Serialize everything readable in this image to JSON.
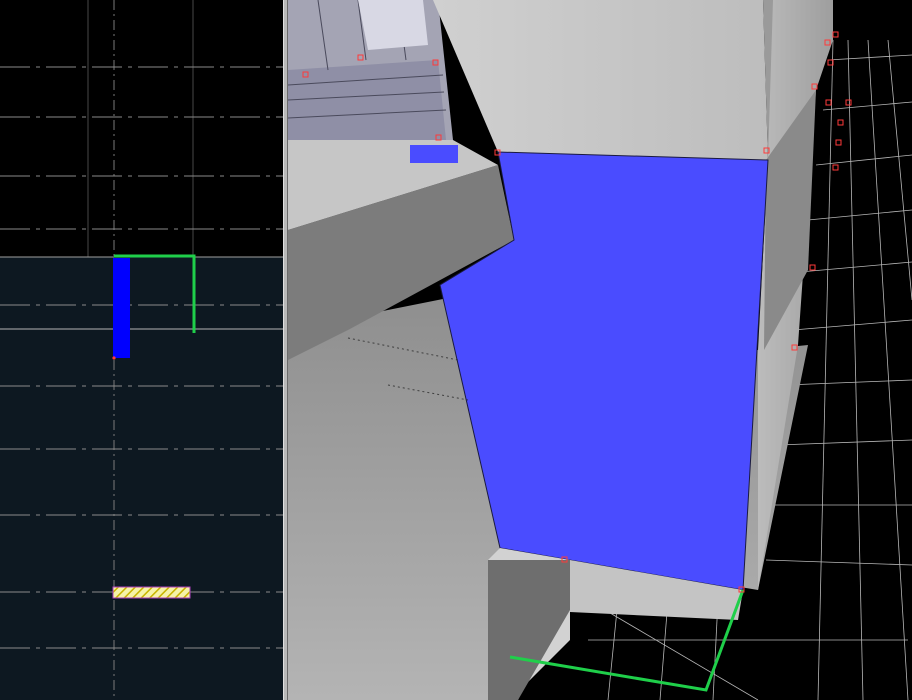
{
  "editor": {
    "viewports": [
      {
        "id": "2d-top",
        "kind": "2D ortho grid"
      },
      {
        "id": "3d-camera",
        "kind": "3D perspective"
      }
    ],
    "colors": {
      "selection_face": "#4a4cff",
      "selection_outline": "#00c040",
      "vertex_marker": "#ff3a3a",
      "grid_line": "#8a8a8a",
      "void_bg": "#000000",
      "map_area_bg": "#0d1821",
      "concrete_light": "#c9c9c9",
      "concrete_dark": "#7c7c7c",
      "brush_blue": "#0000ff",
      "entity_hatch": "#e8e040"
    }
  }
}
